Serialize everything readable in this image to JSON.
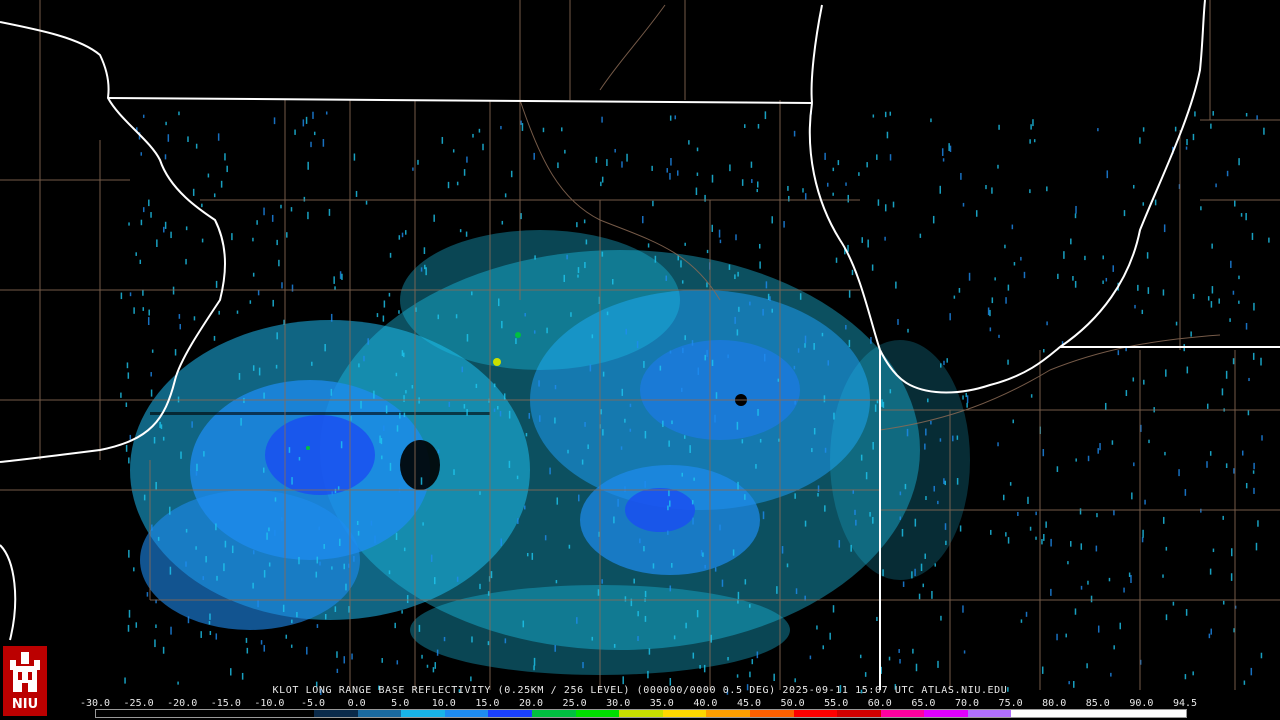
{
  "caption": "KLOT LONG RANGE BASE REFLECTIVITY (0.25KM / 256 LEVEL) (000000/0000 0.5 DEG) 2025-09-11 15:07 UTC  ATLAS.NIU.EDU",
  "colorbar": {
    "ticks": [
      "-30.0",
      "-25.0",
      "-20.0",
      "-15.0",
      "-10.0",
      "-5.0",
      "0.0",
      "5.0",
      "10.0",
      "15.0",
      "20.0",
      "25.0",
      "30.0",
      "35.0",
      "40.0",
      "45.0",
      "50.0",
      "55.0",
      "60.0",
      "65.0",
      "70.0",
      "75.0",
      "80.0",
      "85.0",
      "90.0",
      "94.5"
    ],
    "colors": [
      "#000000",
      "#000000",
      "#000000",
      "#000000",
      "#000000",
      "#0a2a4a",
      "#1a6aa0",
      "#18b4e8",
      "#1e8cf0",
      "#1a40ff",
      "#00c040",
      "#00e000",
      "#c8e000",
      "#ffd800",
      "#ffa000",
      "#ff6000",
      "#ff0000",
      "#d00000",
      "#ff00a0",
      "#e000ff",
      "#b070ff",
      "#ffffff",
      "#ffffff",
      "#ffffff",
      "#ffffff"
    ]
  },
  "logo": {
    "text": "NIU"
  },
  "colors": {
    "boundary": "#ffffff",
    "county": "#8a6a55",
    "echo_light": "#1ec8f0",
    "echo_mid": "#1e8cf0",
    "echo_strong": "#1a40ff"
  }
}
